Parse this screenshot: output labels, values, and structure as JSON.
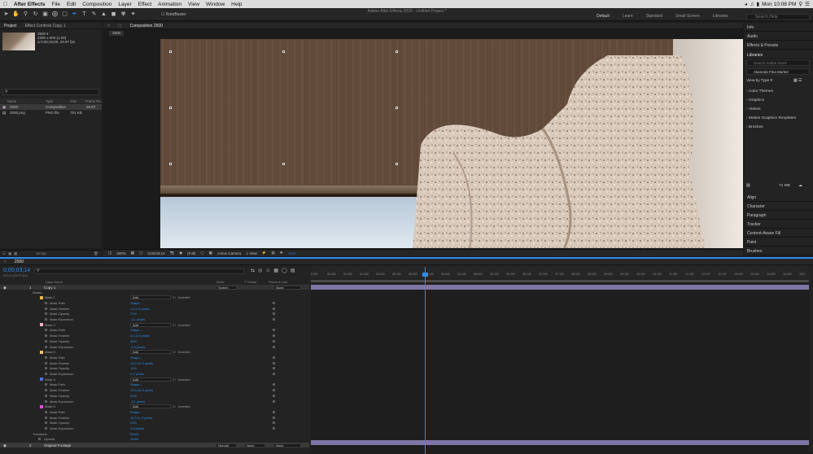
{
  "menubar": {
    "apple": "",
    "app": "After Effects",
    "items": [
      "File",
      "Edit",
      "Composition",
      "Layer",
      "Effect",
      "Animation",
      "View",
      "Window",
      "Help"
    ],
    "clock": "Mon 10:08 PM"
  },
  "window_title": "Adobe After Effects 2020 - Untitled Project *",
  "toolbar": {
    "rotobezier": "RotoBezier"
  },
  "workspaces": [
    "Default",
    "Learn",
    "Standard",
    "Small Screen",
    "Libraries"
  ],
  "search_help": "Search Help",
  "project": {
    "tabs": [
      "Project",
      "Effect Controls Copy 1"
    ],
    "item_name": "2500 ▾",
    "item_info": [
      "2280 x 800 (1.00)",
      "Δ 0;00;15;00, 29.97 fps"
    ],
    "columns": [
      "Name",
      "Type",
      "Size",
      "Frame Ra..."
    ],
    "rows": [
      {
        "name": "2500",
        "type": "Composition",
        "size": "",
        "fr": "29.97"
      },
      {
        "name": "2500.png",
        "type": "PNG file",
        "size": "781 KB",
        "fr": ""
      }
    ],
    "footer_bpc": "16 bpc"
  },
  "composition": {
    "tab": "Composition 2500",
    "crumb": "2500",
    "zoom": "400%",
    "timecode": "0;00;03;14",
    "resolution": "(Full)",
    "camera": "Active Camera",
    "views": "1 View",
    "exposure": "+0.0"
  },
  "right_panel": {
    "panels": [
      "Info",
      "Audio",
      "Effects & Presets"
    ],
    "libraries_tab": "Libraries",
    "lib_search": "Search Adobe Stock",
    "lib_select": "Alameda Flea Market",
    "view_by": "View by Type ▾",
    "categories": [
      "Color Themes",
      "Graphics",
      "Videos",
      "Motion Graphics Templates",
      "Brushes"
    ],
    "storage": "71 MB",
    "bottom_panels": [
      "Align",
      "Character",
      "Paragraph",
      "Tracker",
      "Content-Aware Fill",
      "Paint",
      "Brushes"
    ]
  },
  "timeline": {
    "tab": "2500",
    "timecode": "0;00;03;14",
    "fps": "00104 (29.97 fps)",
    "ruler": [
      "0:00f",
      "00:15f",
      "01:00f",
      "01:15f",
      "02:00f",
      "02:15f",
      "03:00f",
      "03:15f",
      "04:00f",
      "04:15f",
      "05:00f",
      "05:15f",
      "06:00f",
      "06:15f",
      "07:00f",
      "07:15f",
      "08:00f",
      "08:15f",
      "09:00f",
      "09:15f",
      "10:00f",
      "10:15f",
      "11:00f",
      "11:15f",
      "12:00f",
      "12:15f",
      "13:00f",
      "13:15f",
      "14:00f",
      "14:15f",
      "15:0"
    ],
    "columns": {
      "layer": "Layer Name",
      "mode": "Mode",
      "trkmat": "T TrkMat",
      "parent": "Parent & Link"
    },
    "layer1": {
      "num": "1",
      "name": "Copy 1",
      "mode": "Screen",
      "parent": "None"
    },
    "masks_label": "Masks",
    "masks": [
      {
        "name": "Mask 1",
        "color": "#e8b93f",
        "mode": "Add",
        "inverted": "Inverted",
        "path": "Shape...",
        "feather": "1.0,1.0 pixels",
        "opacity": "71%",
        "expansion": "-3.1 pixels"
      },
      {
        "name": "Mask 2",
        "color": "#f2b3c6",
        "mode": "Add",
        "inverted": "Inverted",
        "path": "Shape...",
        "feather": "3.0,3.0 pixels",
        "opacity": "35%",
        "expansion": "-0.5 pixels"
      },
      {
        "name": "Mask 3",
        "color": "#f0c66b",
        "mode": "Add",
        "inverted": "Inverted",
        "path": "Shape...",
        "feather": "10.0,10.0 pixels",
        "opacity": "13%",
        "expansion": "0.1 pixels"
      },
      {
        "name": "Mask 4",
        "color": "#4f6fd6",
        "mode": "Add",
        "inverted": "Inverted",
        "path": "Shape...",
        "feather": "10.0,10.0 pixels",
        "opacity": "34%",
        "expansion": "-3.1 pixels"
      },
      {
        "name": "Mask 5",
        "color": "#e04fd1",
        "mode": "Add",
        "inverted": "Inverted",
        "path": "Shape...",
        "feather": "11.0,11.0 pixels",
        "opacity": "23%",
        "expansion": "0.5 pixels"
      }
    ],
    "prop_labels": [
      "Mask Path",
      "Mask Feather",
      "Mask Opacity",
      "Mask Expansion"
    ],
    "transform_label": "Transform",
    "reset": "Reset",
    "opacity_label": "Opacity",
    "opacity_value": "100%",
    "layer2": {
      "num": "2",
      "name": "Original Footage",
      "mode": "Normal",
      "trkmat": "None",
      "parent": "None"
    }
  }
}
